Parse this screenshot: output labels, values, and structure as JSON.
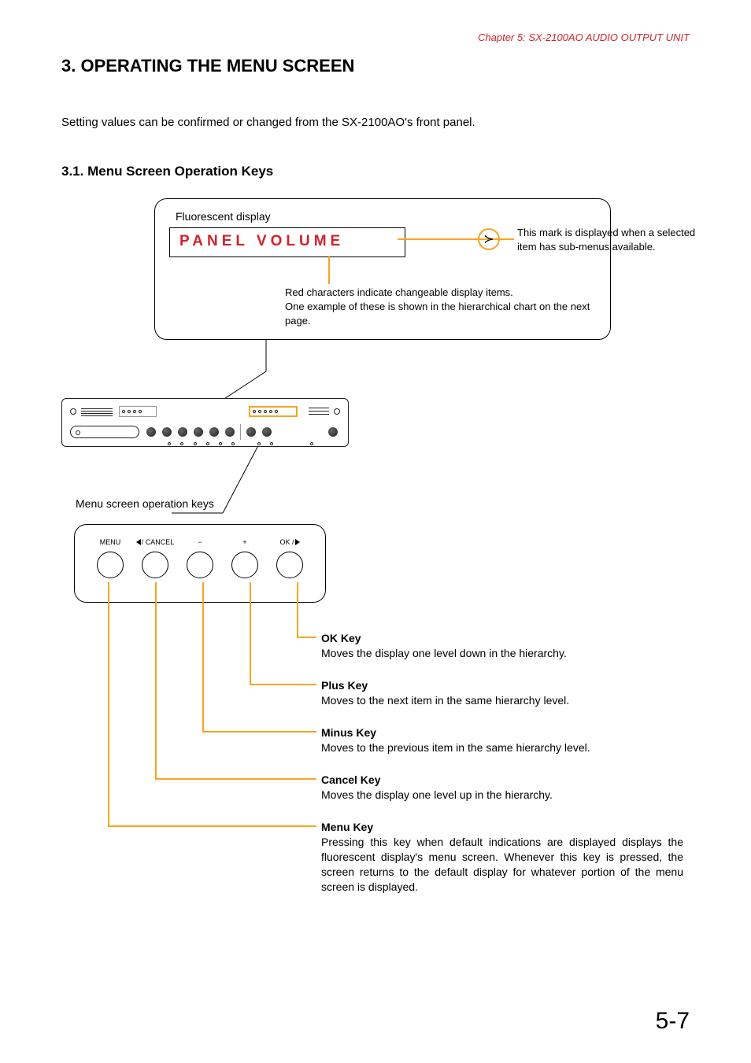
{
  "chapter_header": "Chapter 5: SX-2100AO AUDIO OUTPUT UNIT",
  "section_title": "3. OPERATING THE MENU SCREEN",
  "intro_text": "Setting values can be confirmed or changed from the SX-2100AO's front panel.",
  "subsection_title": "3.1. Menu Screen Operation Keys",
  "display": {
    "label": "Fluorescent display",
    "lcd_text": "PANEL VOLUME",
    "submenu_glyph": "≻",
    "submenu_note": "This mark is displayed when a selected item has sub-menus available.",
    "red_note_line1": "Red characters indicate changeable display items.",
    "red_note_line2": "One example of these is shown in the hierarchical chart on the next page."
  },
  "menu_keys_label": "Menu screen operation keys",
  "keys": {
    "menu": {
      "label": "MENU"
    },
    "cancel": {
      "label_prefix": "",
      "label": "/ CANCEL"
    },
    "minus": {
      "label": "−"
    },
    "plus": {
      "label": "+"
    },
    "ok": {
      "label": "OK /"
    }
  },
  "descriptions": {
    "ok": {
      "title": "OK Key",
      "body": "Moves the display one level down in the hierarchy."
    },
    "plus": {
      "title": "Plus Key",
      "body": "Moves to the next item in the same hierarchy level."
    },
    "minus": {
      "title": "Minus Key",
      "body": "Moves to the previous item in the same hierarchy level."
    },
    "cancel": {
      "title": "Cancel Key",
      "body": "Moves the display one level up in the hierarchy."
    },
    "menu": {
      "title": "Menu Key",
      "body": "Pressing this key when default indications are displayed displays the fluorescent display's menu screen. Whenever this key is pressed, the screen returns to the default display for whatever portion of the menu screen is displayed."
    }
  },
  "page_number": "5-7"
}
